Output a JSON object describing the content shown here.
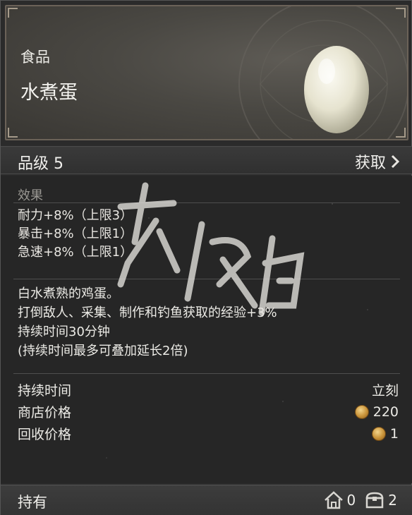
{
  "item": {
    "category": "食品",
    "name": "水煮蛋",
    "grade_label": "品级 5",
    "obtain_label": "获取"
  },
  "effects": {
    "title": "效果",
    "lines": [
      "耐力+8%（上限3）",
      "暴击+8%（上限1）",
      "急速+8%（上限1）"
    ]
  },
  "description": {
    "lines": [
      "白水煮熟的鸡蛋。",
      "打倒敌人、采集、制作和钓鱼获取的经验+3%",
      "持续时间30分钟",
      "(持续时间最多可叠加延长2倍)"
    ]
  },
  "stats": {
    "duration_label": "持续时间",
    "duration_value": "立刻",
    "shop_price_label": "商店价格",
    "shop_price_value": "220",
    "sell_price_label": "回收价格",
    "sell_price_value": "1"
  },
  "footer": {
    "hold_label": "持有",
    "house_count": "0",
    "chest_count": "2"
  },
  "icons": {
    "item_image": "boiled-egg-icon",
    "obtain_arrow": "chevron-right-icon",
    "currency": "gold-coin-icon",
    "house_storage": "house-icon",
    "chest_storage": "chest-icon"
  },
  "colors": {
    "panel_bg": "#262626",
    "header_border": "#6b6258",
    "coin": "#c89238",
    "text": "#ecebe6"
  }
}
